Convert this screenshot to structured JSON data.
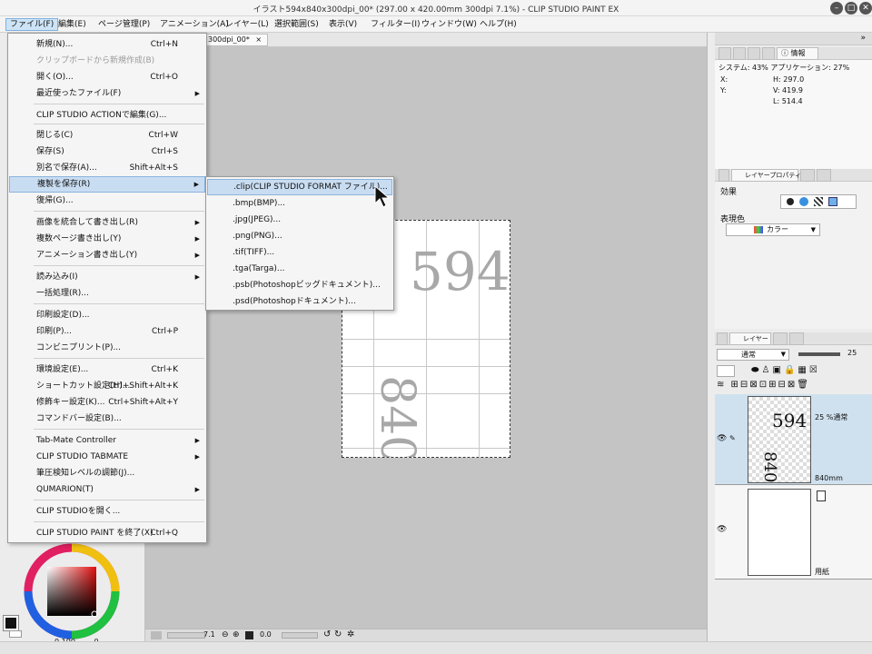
{
  "window": {
    "title": "イラスト594x840x300dpi_00* (297.00 x 420.00mm 300dpi 7.1%) - CLIP STUDIO PAINT EX",
    "minimize": "–",
    "maximize": "□",
    "close": "✕"
  },
  "menubar": [
    "ファイル(F)",
    "編集(E)",
    "ページ管理(P)",
    "アニメーション(A)",
    "レイヤー(L)",
    "選択範囲(S)",
    "表示(V)",
    "フィルター(I)",
    "ウィンドウ(W)",
    "ヘルプ(H)"
  ],
  "doc_tab": {
    "label": "300dpi_00*",
    "close": "×"
  },
  "file_menu": {
    "items": [
      {
        "label": "新規(N)...",
        "shortcut": "Ctrl+N"
      },
      {
        "label": "クリップボードから新規作成(B)",
        "disabled": true
      },
      {
        "label": "開く(O)...",
        "shortcut": "Ctrl+O"
      },
      {
        "label": "最近使ったファイル(F)",
        "submenu": true
      },
      {
        "label": "CLIP STUDIO ACTIONで編集(G)..."
      },
      {
        "label": "閉じる(C)",
        "shortcut": "Ctrl+W"
      },
      {
        "label": "保存(S)",
        "shortcut": "Ctrl+S"
      },
      {
        "label": "別名で保存(A)...",
        "shortcut": "Shift+Alt+S"
      },
      {
        "label": "複製を保存(R)",
        "submenu": true,
        "highlighted": true
      },
      {
        "label": "復帰(G)..."
      },
      {
        "label": "画像を統合して書き出し(R)",
        "submenu": true
      },
      {
        "label": "複数ページ書き出し(Y)",
        "submenu": true
      },
      {
        "label": "アニメーション書き出し(Y)",
        "submenu": true
      },
      {
        "label": "読み込み(I)",
        "submenu": true
      },
      {
        "label": "一括処理(R)..."
      },
      {
        "label": "印刷設定(D)..."
      },
      {
        "label": "印刷(P)...",
        "shortcut": "Ctrl+P"
      },
      {
        "label": "コンビニプリント(P)..."
      },
      {
        "label": "環境設定(E)...",
        "shortcut": "Ctrl+K"
      },
      {
        "label": "ショートカット設定(H)...",
        "shortcut": "Ctrl+Shift+Alt+K"
      },
      {
        "label": "修飾キー設定(K)...",
        "shortcut": "Ctrl+Shift+Alt+Y"
      },
      {
        "label": "コマンドバー設定(B)..."
      },
      {
        "label": "Tab-Mate Controller",
        "submenu": true
      },
      {
        "label": "CLIP STUDIO TABMATE",
        "submenu": true
      },
      {
        "label": "筆圧検知レベルの調節(J)..."
      },
      {
        "label": "QUMARION(T)",
        "submenu": true
      },
      {
        "label": "CLIP STUDIOを開く..."
      },
      {
        "label": "CLIP STUDIO PAINT を終了(X)",
        "shortcut": "Ctrl+Q"
      }
    ]
  },
  "save_copy_submenu": {
    "items": [
      ".clip(CLIP STUDIO FORMAT ファイル)...",
      ".bmp(BMP)...",
      ".jpg(JPEG)...",
      ".png(PNG)...",
      ".tif(TIFF)...",
      ".tga(Targa)...",
      ".psb(Photoshopビッグドキュメント)...",
      ".psd(Photoshopドキュメント)..."
    ]
  },
  "canvas": {
    "width_label": "594",
    "height_label": "840"
  },
  "info_panel": {
    "tab_label": "情報",
    "system_line": "システム: 43%  アプリケーション: 27%",
    "x_label": "X:",
    "y_label": "Y:",
    "h_value": "H: 297.0",
    "v_value": "V: 419.9",
    "l_value": "L: 514.4"
  },
  "layer_property": {
    "tab_label": "レイヤープロパティ",
    "effect_label": "効果",
    "color_label": "表現色",
    "color_value": "カラー"
  },
  "layer_panel": {
    "tab_label": "レイヤー",
    "blend_mode": "通常",
    "opacity": "25",
    "layers": [
      {
        "info": "25 %通常",
        "name": "840mm"
      },
      {
        "info": "",
        "name": "用紙"
      }
    ]
  },
  "status": {
    "zoom": "7.1",
    "rotation": "0.0"
  },
  "color_wheel": {
    "v1": "0",
    "v2": "100",
    "v3": "0"
  },
  "colors": {
    "menu_highlight": "#c9ddf2",
    "canvas_bg": "#c4c4c4",
    "layer_selected": "#cfe1ef"
  }
}
